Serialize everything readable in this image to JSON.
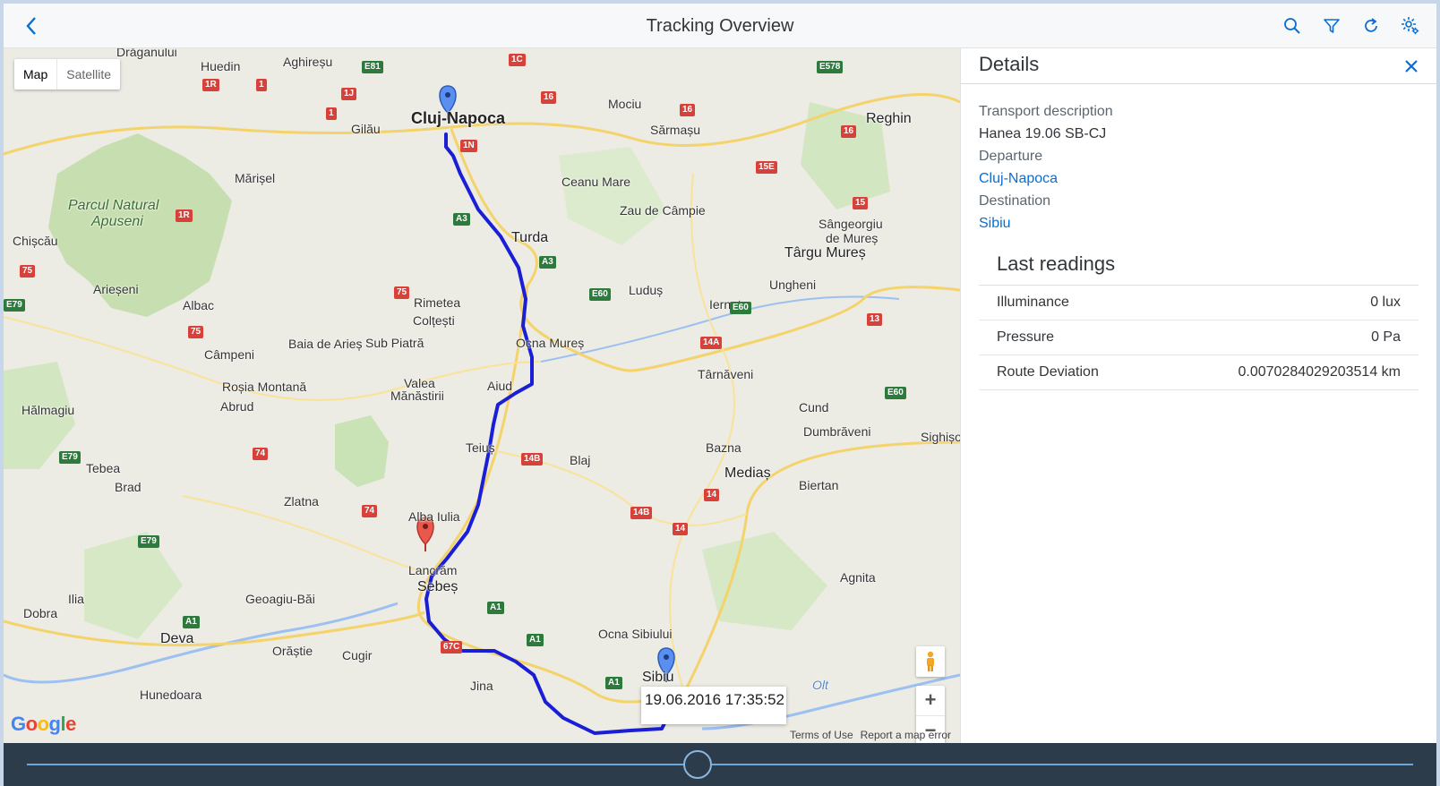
{
  "header": {
    "title": "Tracking Overview"
  },
  "map": {
    "type_buttons": [
      "Map",
      "Satellite"
    ],
    "active_type": "Map",
    "places": {
      "cluj": "Cluj-Napoca",
      "turda": "Turda",
      "targu_mures": "Târgu Mureș",
      "alba_iulia": "Alba Iulia",
      "sebes": "Sebeș",
      "sibiu": "Sibiu",
      "deva": "Deva",
      "medias": "Mediaș",
      "huedin": "Huedin",
      "gilau": "Gilău",
      "dragan": "Drăganului",
      "aghiresu": "Aghireșu",
      "mociu": "Mociu",
      "sarmasu": "Sărmașu",
      "reghin": "Reghin",
      "marisel": "Mărișel",
      "ceanu": "Ceanu Mare",
      "zau": "Zau de Câmpie",
      "sangeorgiu": "Sângeorgiu",
      "de_mures": "de Mureș",
      "chiscau": "Chișcău",
      "arieseni": "Arieșeni",
      "albac": "Albac",
      "rimetea": "Rimetea",
      "coltesti": "Colțești",
      "ludus": "Luduș",
      "iernut": "Iernut",
      "ungheni": "Ungheni",
      "campeni": "Câmpeni",
      "baia": "Baia de Arieș",
      "sub_piatra": "Sub Piatră",
      "ocna_mures": "Ocna Mureș",
      "rosia": "Roșia Montană",
      "valea": "Valea",
      "manastirii": "Mănăstirii",
      "aiud": "Aiud",
      "tarnaveni": "Târnăveni",
      "halmagiu": "Hălmagiu",
      "abrud": "Abrud",
      "cund": "Cund",
      "dumbraveni": "Dumbrăveni",
      "sighisoara": "Sighișo",
      "tebea": "Tebea",
      "brad": "Brad",
      "teius": "Teiuș",
      "blaj": "Blaj",
      "bazna": "Bazna",
      "biertan": "Biertan",
      "zlatna": "Zlatna",
      "lancram": "Lancrăm",
      "ilia": "Ilia",
      "dobra": "Dobra",
      "geoagiu": "Geoagiu-Băi",
      "agnita": "Agnita",
      "orastie": "Orăștie",
      "cugir": "Cugir",
      "ocna_sibiului": "Ocna Sibiului",
      "hunedoara": "Hunedoara",
      "jina": "Jina",
      "park": "Parcul Natural",
      "park2": "Apuseni",
      "olt": "Olt"
    },
    "roads": [
      "E81",
      "1C",
      "E578",
      "1R",
      "1",
      "1J",
      "16",
      "1N",
      "15E",
      "A3",
      "15",
      "75",
      "E79",
      "E60",
      "14A",
      "13",
      "14B",
      "14",
      "74",
      "A1",
      "67C"
    ],
    "tooltip": "19.06.2016 17:35:52",
    "footer": [
      "Terms of Use",
      "Report a map error"
    ],
    "logo": "Google"
  },
  "details": {
    "title": "Details",
    "fields": [
      {
        "label": "Transport description",
        "value": "Hanea 19.06 SB-CJ",
        "link": false
      },
      {
        "label": "Departure",
        "value": "Cluj-Napoca",
        "link": true
      },
      {
        "label": "Destination",
        "value": "Sibiu",
        "link": true
      }
    ],
    "readings_title": "Last readings",
    "readings": [
      {
        "name": "Illuminance",
        "value": "0 lux"
      },
      {
        "name": "Pressure",
        "value": "0 Pa"
      },
      {
        "name": "Route Deviation",
        "value": "0.0070284029203514 km"
      }
    ]
  },
  "colors": {
    "route": "#1a1fd6",
    "marker_blue": "#5a8ef0",
    "marker_red": "#e8584c",
    "link": "#0a6ed1",
    "timeline_bg": "#2d3c4a"
  }
}
